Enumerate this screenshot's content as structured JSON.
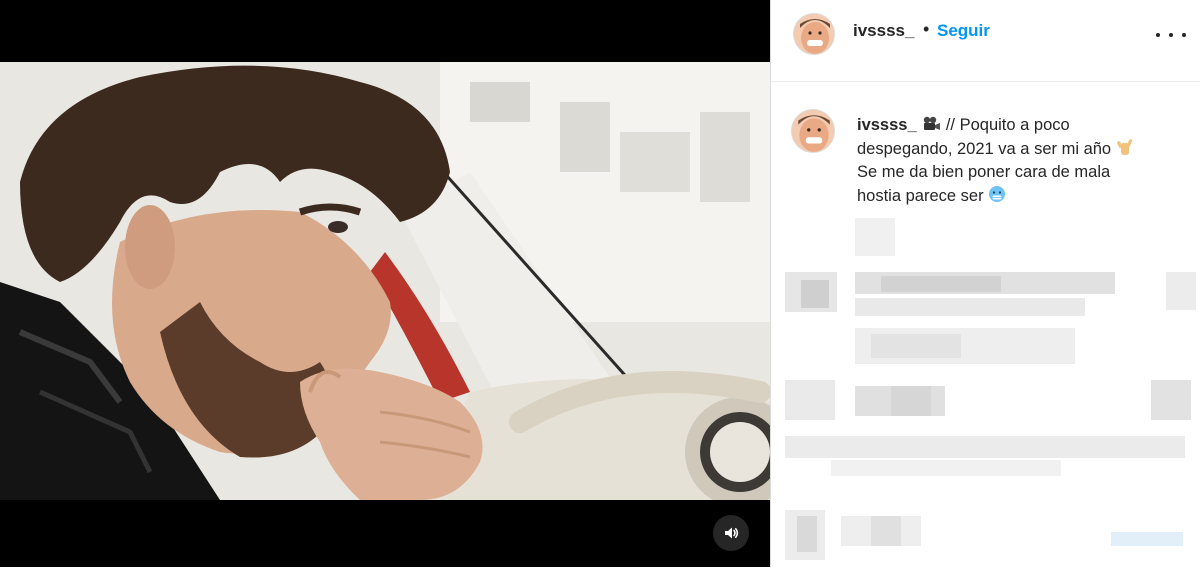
{
  "post": {
    "username": "ivssss_",
    "separator": "•",
    "follow_label": "Seguir"
  },
  "caption": {
    "username": "ivssss_",
    "line1": " // Poquito a poco",
    "line2": "despegando, 2021 va a ser mi año",
    "line3": "Se me da bien poner cara de mala",
    "line4": "hostia parece ser"
  },
  "icons": {
    "camera": "movie-camera-icon",
    "sign": "call-me-hand-icon",
    "face": "cold-face-icon",
    "sound": "speaker-icon",
    "more": "more-options-icon"
  },
  "colors": {
    "link_blue": "#0095f6",
    "text": "#262626",
    "border": "#dbdbdb"
  }
}
